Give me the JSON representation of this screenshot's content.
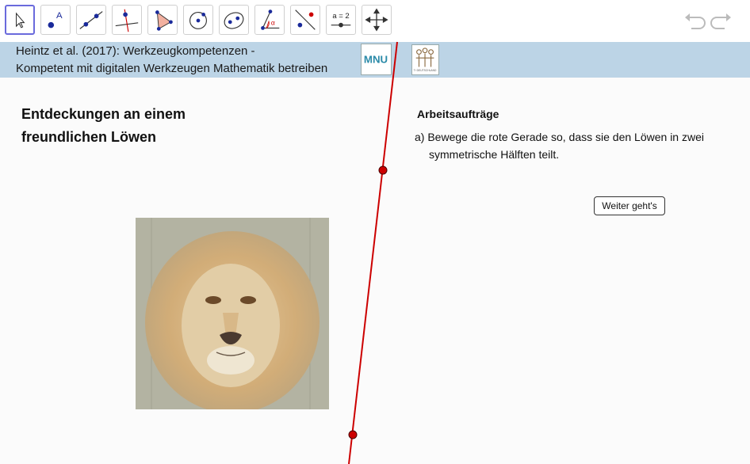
{
  "toolbar": {
    "tools": [
      {
        "name": "move-tool",
        "icon": "arrow-cursor-icon"
      },
      {
        "name": "point-tool",
        "icon": "point-icon",
        "label": "A"
      },
      {
        "name": "line-tool",
        "icon": "line-icon"
      },
      {
        "name": "perpendicular-line-tool",
        "icon": "perpendicular-icon"
      },
      {
        "name": "polygon-tool",
        "icon": "polygon-icon"
      },
      {
        "name": "circle-tool",
        "icon": "circle-icon"
      },
      {
        "name": "ellipse-tool",
        "icon": "ellipse-icon"
      },
      {
        "name": "angle-tool",
        "icon": "angle-icon",
        "label": "α"
      },
      {
        "name": "reflect-tool",
        "icon": "reflect-icon"
      },
      {
        "name": "slider-tool",
        "icon": "slider-icon",
        "label": "a = 2"
      },
      {
        "name": "move-graphics-tool",
        "icon": "move-view-icon"
      }
    ],
    "undo_icon": "undo-icon",
    "redo_icon": "redo-icon"
  },
  "banner": {
    "line1": "Heintz et al. (2017): Werkzeugkompetenzen -",
    "line2": "Kompetent mit digitalen Werkzeugen Mathematik betreiben",
    "logo1": "MNU",
    "logo2": "T³ DEUTSCHLAND"
  },
  "main": {
    "title_line1": "Entdeckungen an einem",
    "title_line2": "freundlichen Löwen",
    "tasks_heading": "Arbeitsaufträge",
    "task_a_line1": "a) Bewege die rote Gerade so, dass sie den Löwen in zwei",
    "task_a_line2": "symmetrische Hälften teilt.",
    "next_button": "Weiter geht's"
  },
  "colors": {
    "line": "#cc0000",
    "banner": "#bcd4e6",
    "accent": "#6a6adc"
  }
}
